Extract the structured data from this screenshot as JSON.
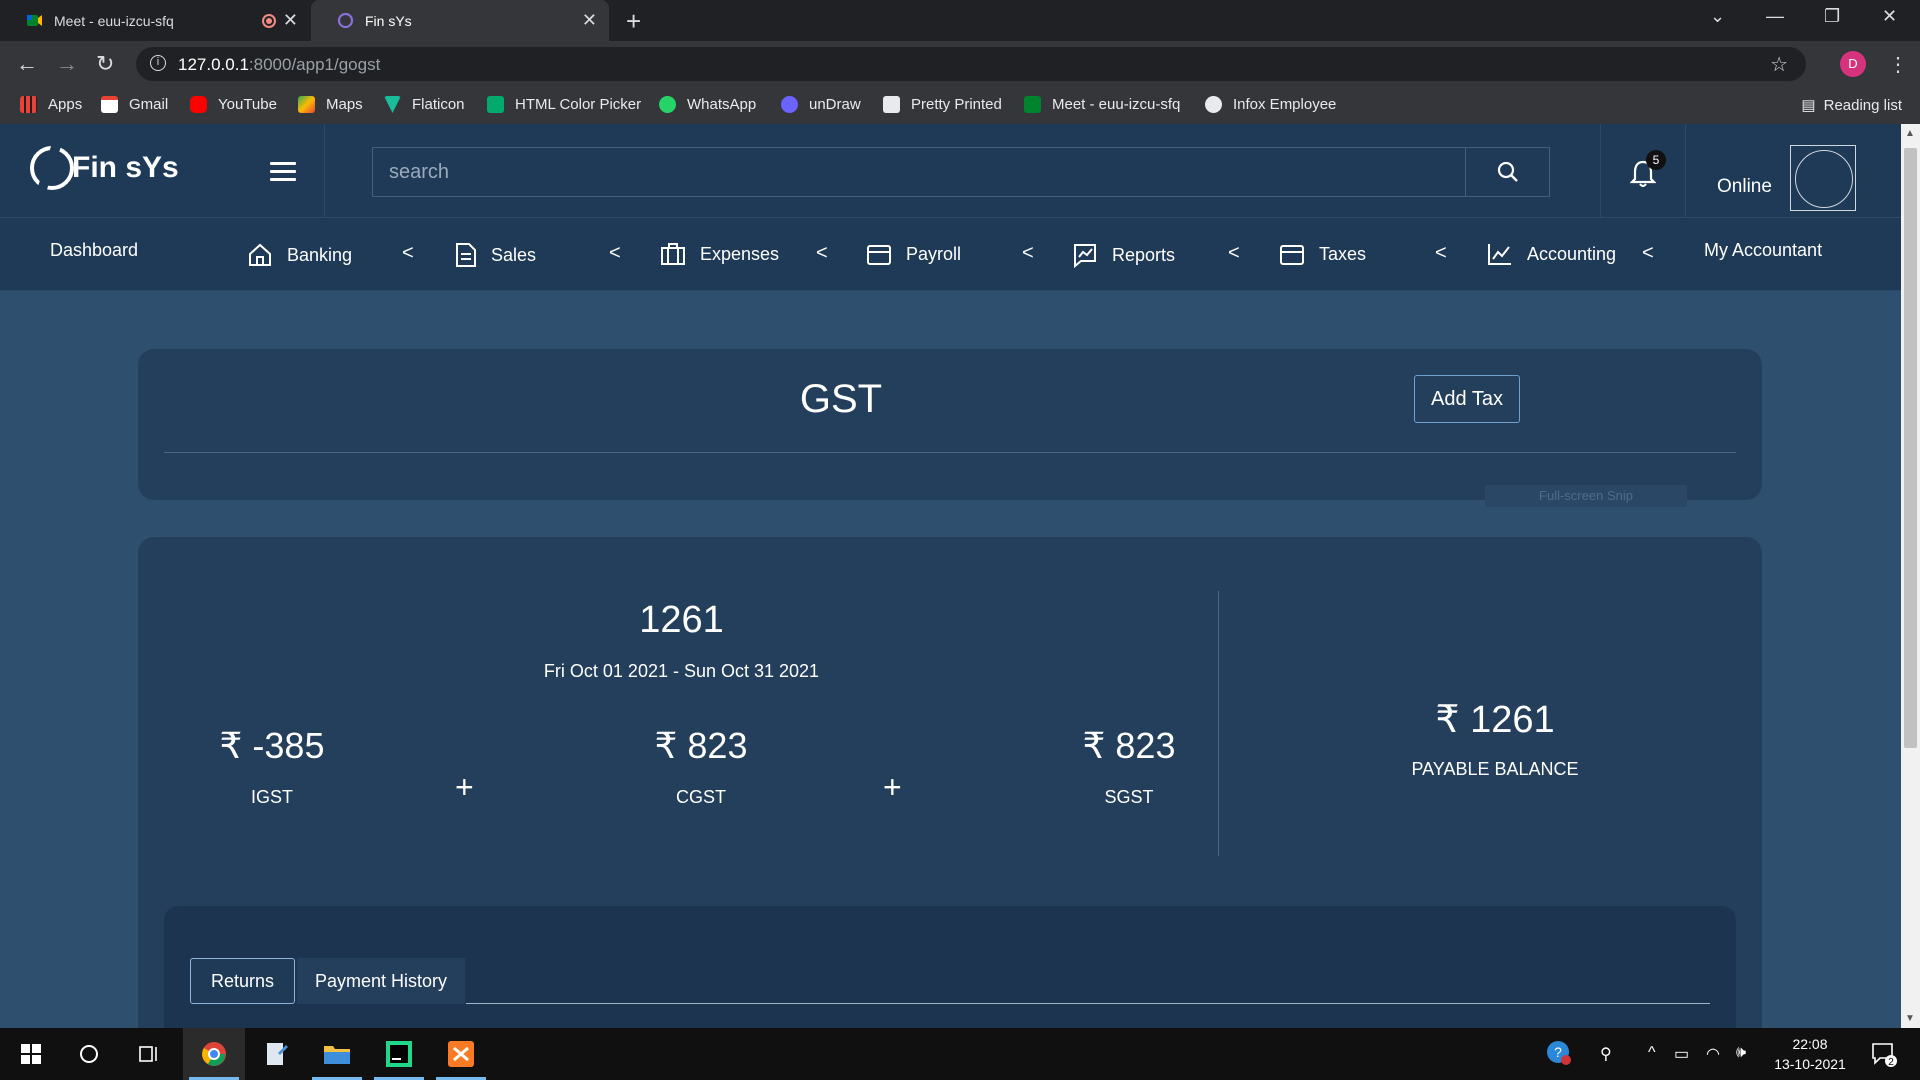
{
  "browser": {
    "tabs": [
      {
        "title": "Meet - euu-izcu-sfq",
        "icon": "google-meet-icon"
      },
      {
        "title": "Fin sYs",
        "icon": "finsys-logo-icon"
      }
    ],
    "url_host": "127.0.0.1",
    "url_path": ":8000/app1/gogst",
    "profile_initial": "D",
    "bookmarks": [
      "Apps",
      "Gmail",
      "YouTube",
      "Maps",
      "Flaticon",
      "HTML Color Picker",
      "WhatsApp",
      "unDraw",
      "Pretty Printed",
      "Meet - euu-izcu-sfq",
      "Infox Employee"
    ],
    "reading_list": "Reading list"
  },
  "header": {
    "brand": "Fin sYs",
    "search_placeholder": "search",
    "notification_count": "5",
    "status": "Online"
  },
  "nav": {
    "dashboard": "Dashboard",
    "banking": "Banking",
    "sales": "Sales",
    "expenses": "Expenses",
    "payroll": "Payroll",
    "reports": "Reports",
    "taxes": "Taxes",
    "accounting": "Accounting",
    "my_accountant": "My Accountant",
    "chevron": "<"
  },
  "gst": {
    "title": "GST",
    "add_tax": "Add Tax",
    "snip_overlay": "Full-screen Snip",
    "total": "1261",
    "period": "Fri Oct 01 2021 - Sun Oct 31 2021",
    "igst_amount": "₹ -385",
    "igst_label": "IGST",
    "cgst_amount": "₹ 823",
    "cgst_label": "CGST",
    "sgst_amount": "₹ 823",
    "sgst_label": "SGST",
    "plus": "+",
    "payable_amount": "₹ 1261",
    "payable_label": "PAYABLE BALANCE",
    "tabs": [
      "Returns",
      "Payment History"
    ]
  },
  "taskbar": {
    "time": "22:08",
    "date": "13-10-2021",
    "notifications": "2"
  },
  "colors": {
    "page_bg": "#2f4f6f",
    "header_bg": "#1e3a56",
    "card_bg": "#233f5c"
  }
}
